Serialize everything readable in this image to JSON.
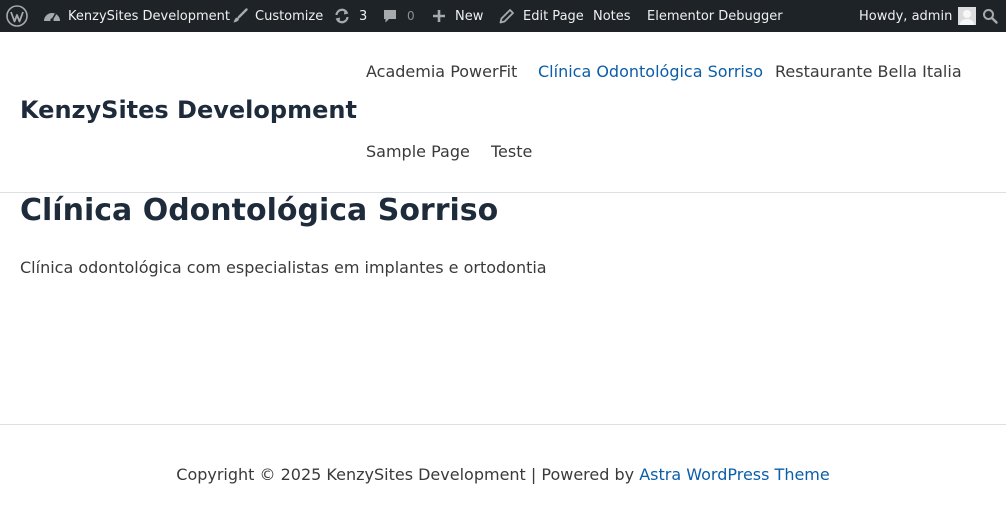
{
  "admin_bar": {
    "site_name": "KenzySites Development",
    "customize": "Customize",
    "updates_count": "3",
    "comments_count": "0",
    "new": "New",
    "edit_page": "Edit Page",
    "notes": "Notes",
    "debugger": "Elementor Debugger",
    "greeting": "Howdy, admin"
  },
  "header": {
    "site_title": "KenzySites Development",
    "nav": [
      {
        "label": "Academia PowerFit"
      },
      {
        "label": "Clínica Odontológica Sorriso",
        "current": true
      },
      {
        "label": "Restaurante Bella Italia"
      },
      {
        "label": "Sample Page"
      },
      {
        "label": "Teste"
      }
    ]
  },
  "content": {
    "title": "Clínica Odontológica Sorriso",
    "text": "Clínica odontológica com especialistas em implantes e ortodontia"
  },
  "footer": {
    "text_prefix": "Copyright © 2025 KenzySites Development | Powered by ",
    "link_label": "Astra WordPress Theme"
  },
  "colors": {
    "admin_bar_bg": "#1d2327",
    "accent_link": "#0b5ea8",
    "heading": "#1e2b3b"
  }
}
